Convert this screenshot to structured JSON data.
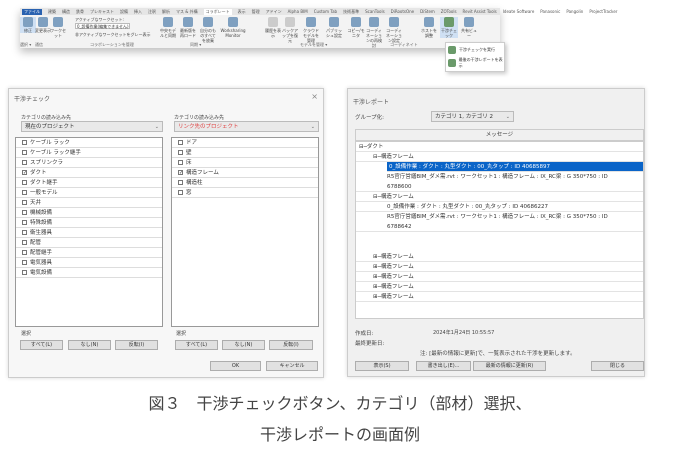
{
  "ribbon": {
    "tabs": [
      "ファイル",
      "建築",
      "構造",
      "鉄骨",
      "プレキャスト",
      "設備",
      "挿入",
      "注釈",
      "解析",
      "マス & 外構",
      "コラボレート",
      "表示",
      "管理",
      "アドイン",
      "Alpha BIM",
      "Custom Tab",
      "技術基準",
      "ScanTools",
      "DiRootsOne",
      "DiStem",
      "ZOTools",
      "Revit Assist Tools",
      "Ideate Software",
      "Panasonic",
      "Pangolin",
      "ProjectTracker"
    ],
    "active_tab": "コラボレート",
    "buttons": [
      "修正",
      "変更表示",
      "ワークセット",
      "中央モデルと同期",
      "最新版を再ロード",
      "自分のものすべてを放棄",
      "Worksharing Monitor",
      "履歴を表示",
      "バックアップを復元",
      "クラウド モデルを管理",
      "パブリッシュ設定",
      "コピー/モニタ",
      "コーディネーションの再検討",
      "コーディネーション設定",
      "ホストを調整",
      "干渉チェック",
      "共有ビュー"
    ],
    "active_workset_label": "アクティブなワークセット:",
    "active_workset_value": "0_設備作業(編集できません)",
    "gray_out_label": "非アクティブなワークセットをグレー表示",
    "groups": [
      "選択 ▾",
      "通信",
      "コラボレーションを管理",
      "同期 ▾",
      "モデルを管理 ▾",
      "コーディネイト"
    ],
    "menu": [
      "干渉チェックを実行",
      "最後の干渉レポートを表示"
    ]
  },
  "check_dialog": {
    "title": "干渉チェック",
    "close": "×",
    "left": {
      "label": "カテゴリの読み込み先",
      "source": "現在のプロジェクト",
      "items": [
        {
          "name": "ケーブル ラック",
          "checked": false
        },
        {
          "name": "ケーブル ラック継手",
          "checked": false
        },
        {
          "name": "スプリンクラ",
          "checked": false
        },
        {
          "name": "ダクト",
          "checked": true
        },
        {
          "name": "ダクト継手",
          "checked": false
        },
        {
          "name": "一般モデル",
          "checked": false
        },
        {
          "name": "天井",
          "checked": false
        },
        {
          "name": "機械設備",
          "checked": false
        },
        {
          "name": "特殊設備",
          "checked": false
        },
        {
          "name": "衛生器具",
          "checked": false
        },
        {
          "name": "配管",
          "checked": false
        },
        {
          "name": "配管継手",
          "checked": false
        },
        {
          "name": "電気器具",
          "checked": false
        },
        {
          "name": "電気設備",
          "checked": false
        }
      ]
    },
    "right": {
      "label": "カテゴリの読み込み先",
      "source": "リンク先のプロジェクト",
      "items": [
        {
          "name": "ドア",
          "checked": false
        },
        {
          "name": "壁",
          "checked": false
        },
        {
          "name": "床",
          "checked": false
        },
        {
          "name": "構造フレーム",
          "checked": true
        },
        {
          "name": "構造柱",
          "checked": false
        },
        {
          "name": "窓",
          "checked": false
        }
      ]
    },
    "select_label": "選択",
    "all": "すべて(L)",
    "none": "なし(N)",
    "invert": "反転(I)",
    "ok": "OK",
    "cancel": "キャンセル"
  },
  "report_dialog": {
    "title": "干渉レポート",
    "group_label": "グループ化:",
    "group_value": "カテゴリ 1, カテゴリ 2",
    "column": "メッセージ",
    "rows": [
      {
        "text": "⊟─ダクト",
        "indent": 0
      },
      {
        "text": "⊟─構造フレーム",
        "indent": 1
      },
      {
        "text": "0_設備作業 : ダクト : 丸型ダクト : 00_丸タップ : ID 40685897",
        "indent": 2,
        "selected": true
      },
      {
        "text": "R5官庁営繕BIM_ダメ需.rvt : ワークセット1 : 構造フレーム : IX_RC梁 : G 350*750 : ID",
        "text2": "6788600",
        "indent": 2
      },
      {
        "text": "⊟─構造フレーム",
        "indent": 1
      },
      {
        "text": "0_設備作業 : ダクト : 丸型ダクト : 00_丸タップ : ID 40686227",
        "indent": 2
      },
      {
        "text": "R5官庁営繕BIM_ダメ需.rvt : ワークセット1 : 構造フレーム : IX_RC梁 : G 350*750 : ID",
        "text2": "6788642",
        "indent": 2
      },
      {
        "text": "⊞─構造フレーム",
        "indent": 1
      },
      {
        "text": "⊞─構造フレーム",
        "indent": 1
      },
      {
        "text": "⊞─構造フレーム",
        "indent": 1
      },
      {
        "text": "⊞─構造フレーム",
        "indent": 1
      },
      {
        "text": "⊞─構造フレーム",
        "indent": 1
      }
    ],
    "created_label": "作成日:",
    "created_value": "2024年1月24日 10:55:57",
    "updated_label": "最終更新日:",
    "note": "注: [最新の情報に更新]で、一覧表示された干渉を更新します。",
    "show": "表示(S)",
    "export": "書き出し(E)...",
    "refresh": "最新の情報に更新(R)",
    "close": "閉じる"
  },
  "caption": {
    "line1": "図３　干渉チェックボタン、カテゴリ（部材）選択、",
    "line2": "干渉レポートの画面例"
  }
}
